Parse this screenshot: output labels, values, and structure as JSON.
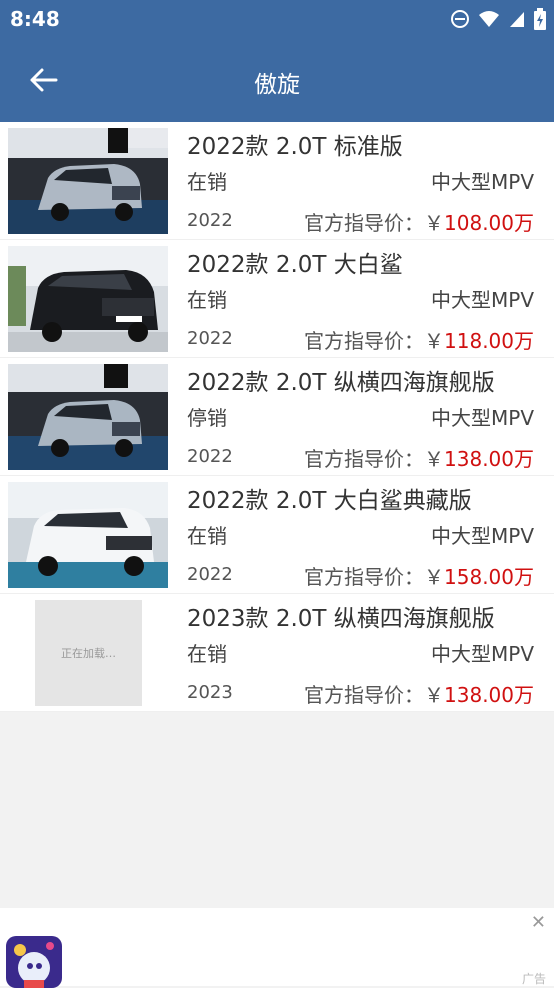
{
  "status_bar": {
    "time": "8:48"
  },
  "header": {
    "title": "傲旋"
  },
  "price_prefix": "官方指导价：￥",
  "cars": [
    {
      "title": "2022款 2.0T 标准版",
      "status": "在销",
      "type": "中大型MPV",
      "year": "2022",
      "price": "108.00万"
    },
    {
      "title": "2022款 2.0T 大白鲨",
      "status": "在销",
      "type": "中大型MPV",
      "year": "2022",
      "price": "118.00万"
    },
    {
      "title": "2022款 2.0T 纵横四海旗舰版",
      "status": "停销",
      "type": "中大型MPV",
      "year": "2022",
      "price": "138.00万"
    },
    {
      "title": "2022款 2.0T 大白鲨典藏版",
      "status": "在销",
      "type": "中大型MPV",
      "year": "2022",
      "price": "158.00万"
    },
    {
      "title": "2023款 2.0T 纵横四海旗舰版",
      "status": "在销",
      "type": "中大型MPV",
      "year": "2023",
      "price": "138.00万"
    }
  ],
  "loading_text": "正在加载…",
  "ad": {
    "label": "广告",
    "close": "✕"
  },
  "colors": {
    "header_bg": "#3d6aa2",
    "price": "#d01010",
    "page_bg": "#f2f2f2"
  }
}
